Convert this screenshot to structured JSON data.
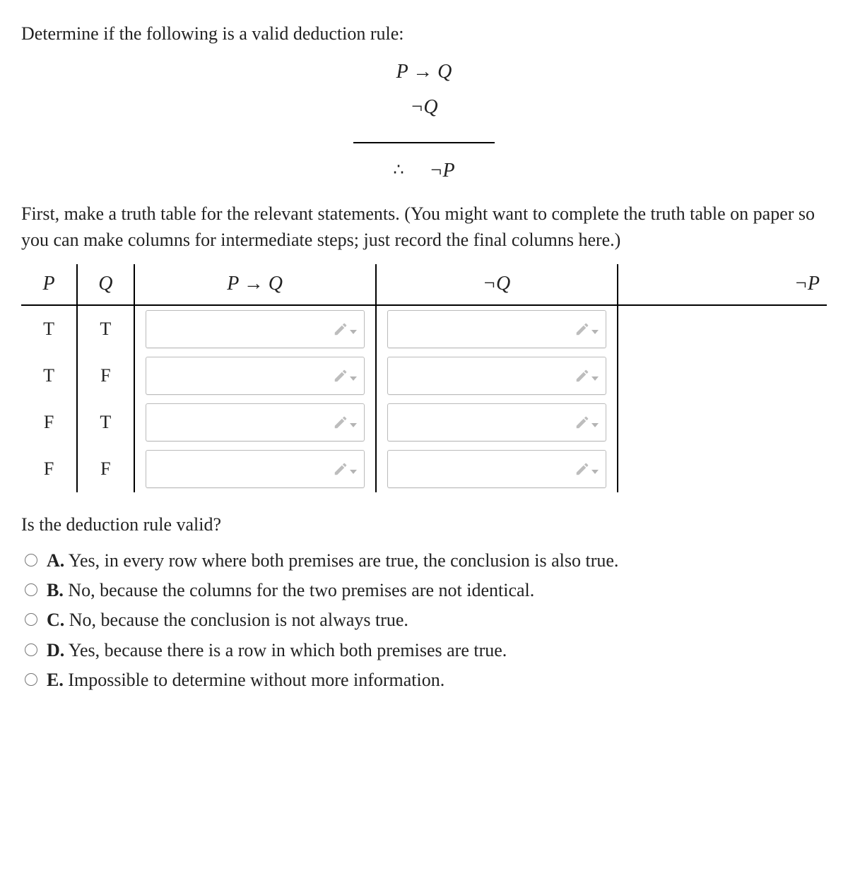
{
  "intro": "Determine if the following is a valid deduction rule:",
  "deduction": {
    "premise1": "P → Q",
    "premise2": "¬Q",
    "therefore": "∴",
    "conclusion": "¬P"
  },
  "instructions": "First, make a truth table for the relevant statements. (You might want to complete the truth table on paper so you can make columns for intermediate steps; just record the final columns here.)",
  "truth_table": {
    "headers": {
      "P": "P",
      "Q": "Q",
      "c1": "P → Q",
      "c2": "¬Q",
      "c3": "¬P"
    },
    "rows": [
      {
        "P": "T",
        "Q": "T",
        "c1": "",
        "c2": "",
        "c3": ""
      },
      {
        "P": "T",
        "Q": "F",
        "c1": "",
        "c2": "",
        "c3": ""
      },
      {
        "P": "F",
        "Q": "T",
        "c1": "",
        "c2": "",
        "c3": ""
      },
      {
        "P": "F",
        "Q": "F",
        "c1": "",
        "c2": "",
        "c3": ""
      }
    ]
  },
  "question2": "Is the deduction rule valid?",
  "choices": {
    "A": {
      "letter": "A.",
      "text": " Yes, in every row where both premises are true, the conclusion is also true."
    },
    "B": {
      "letter": "B.",
      "text": " No, because the columns for the two premises are not identical."
    },
    "C": {
      "letter": "C.",
      "text": " No, because the conclusion is not always true."
    },
    "D": {
      "letter": "D.",
      "text": " Yes, because there is a row in which both premises are true."
    },
    "E": {
      "letter": "E.",
      "text": " Impossible to determine without more information."
    }
  }
}
